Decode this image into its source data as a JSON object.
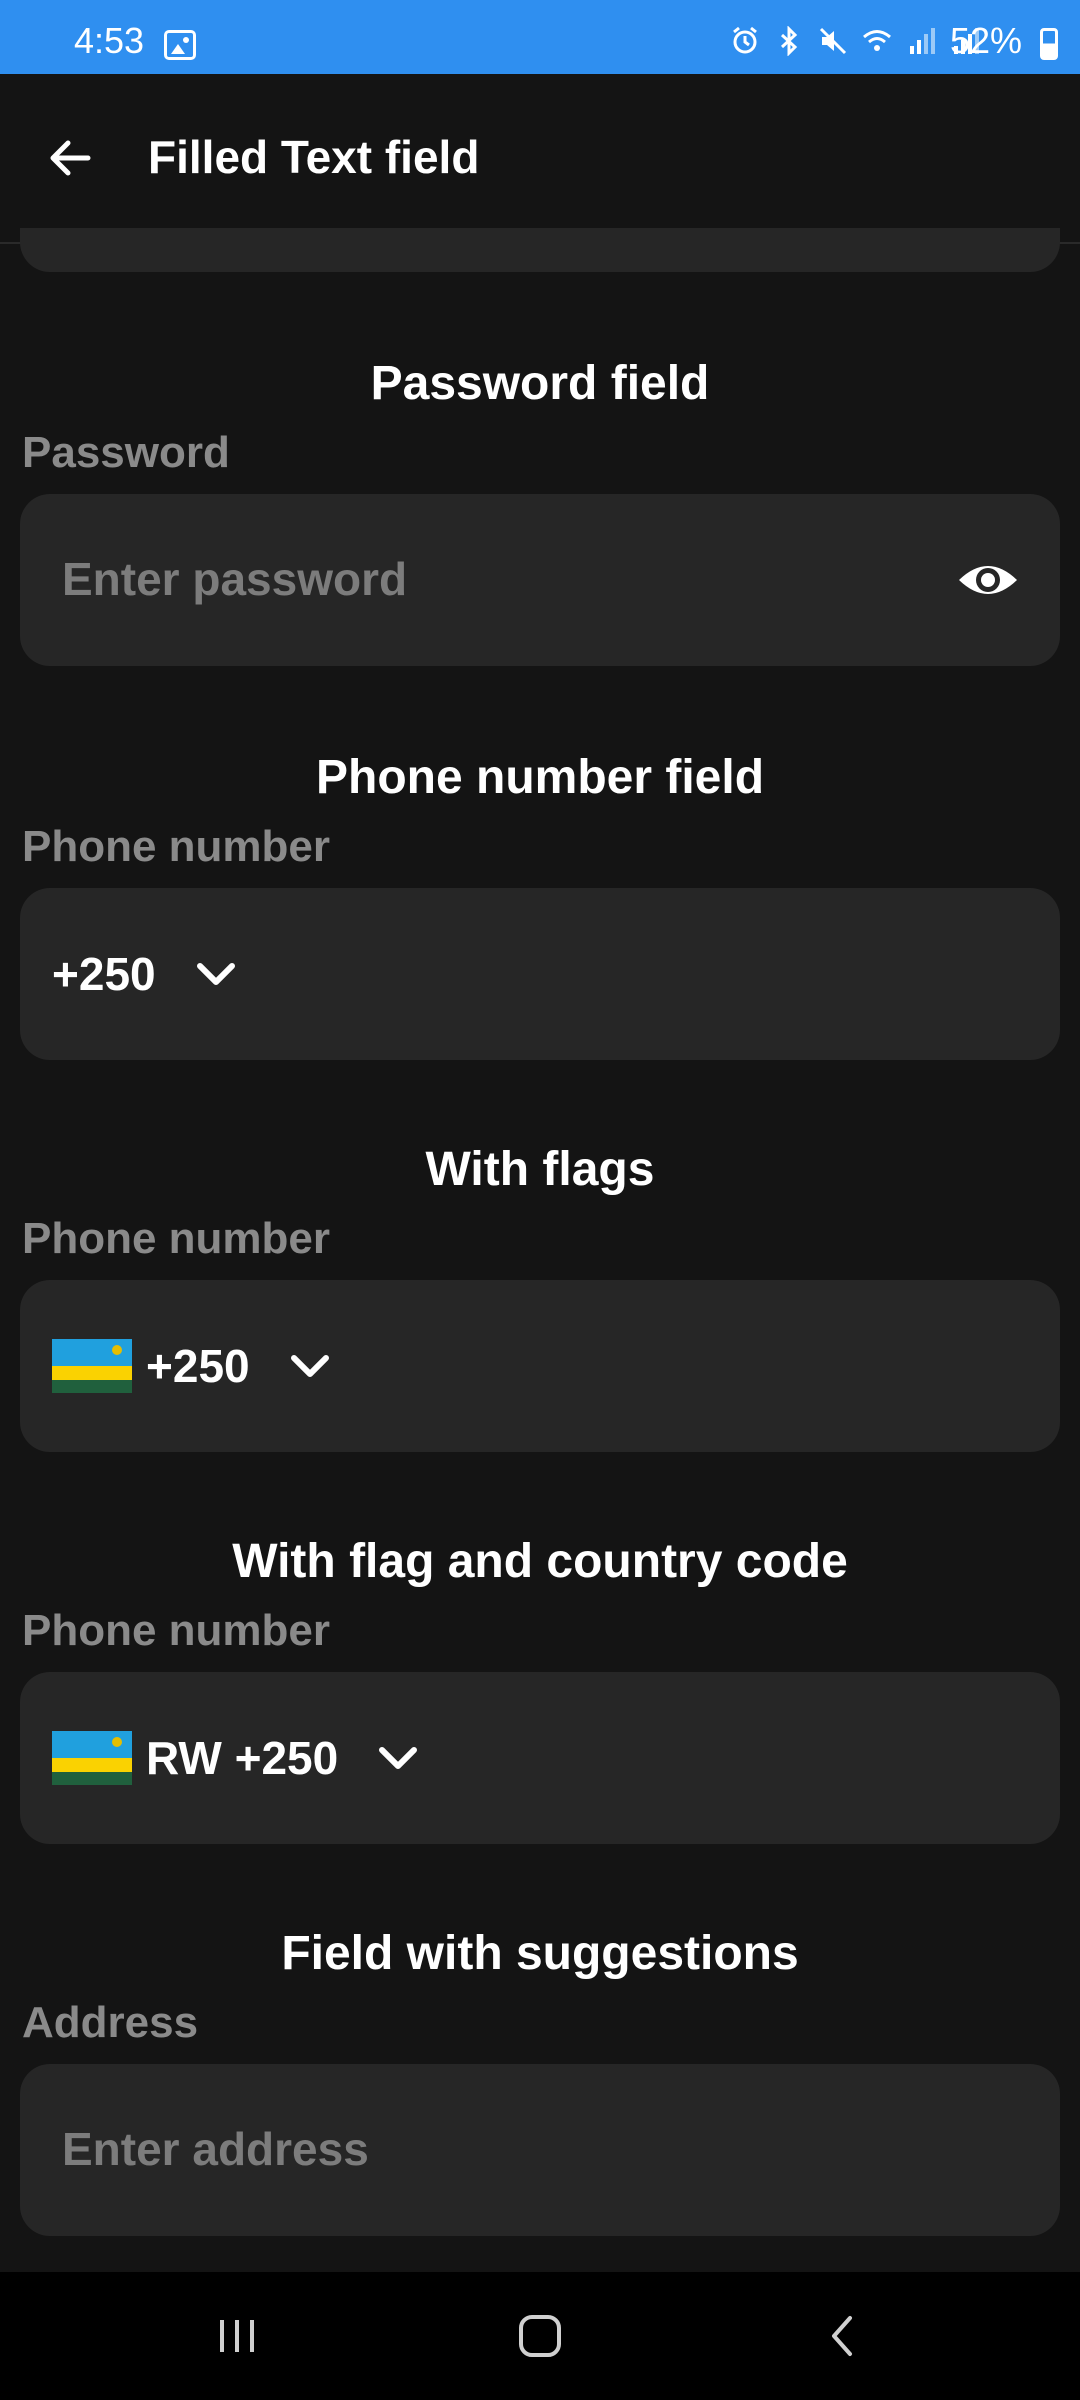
{
  "status_bar": {
    "time": "4:53",
    "battery": "52%",
    "icons": [
      "gallery-icon",
      "alarm-icon",
      "bluetooth-icon",
      "mute-icon",
      "wifi-icon",
      "signal-icon",
      "signal-icon"
    ]
  },
  "app_bar": {
    "title": "Filled Text field",
    "back_icon": "arrow-left-icon"
  },
  "sections": {
    "password": {
      "title": "Password field",
      "label": "Password",
      "placeholder": "Enter password",
      "trailing_icon": "eye-icon"
    },
    "phone": {
      "title": "Phone number field",
      "label": "Phone number",
      "code": "+250"
    },
    "flags": {
      "title": "With flags",
      "label": "Phone number",
      "code": "+250",
      "flag": "rwanda-flag"
    },
    "flag_country": {
      "title": "With flag and country code",
      "label": "Phone number",
      "code": "RW +250",
      "flag": "rwanda-flag"
    },
    "suggestions": {
      "title": "Field with suggestions",
      "label": "Address",
      "placeholder": "Enter address"
    }
  },
  "nav_bar": {
    "buttons": [
      "recents-icon",
      "home-icon",
      "back-icon"
    ]
  },
  "colors": {
    "status_bar": "#2f8ff0",
    "background": "#141414",
    "field_fill": "#262626",
    "label_gray": "#8a8a8a",
    "rwanda_blue": "#20a0de",
    "rwanda_yellow": "#fad201",
    "rwanda_green": "#20603d"
  }
}
